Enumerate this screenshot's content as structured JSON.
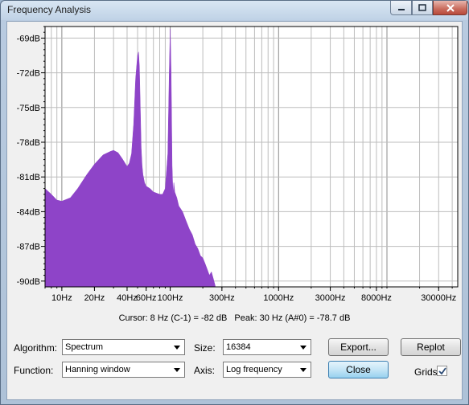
{
  "window": {
    "title": "Frequency Analysis",
    "accent": "#8e44c8"
  },
  "titlebar_buttons": [
    {
      "name": "minimize-button",
      "icon": "minimize-icon"
    },
    {
      "name": "maximize-button",
      "icon": "maximize-icon"
    },
    {
      "name": "close-window-button",
      "icon": "close-icon"
    }
  ],
  "plot": {
    "y_ticks": [
      "-69dB",
      "-72dB",
      "-75dB",
      "-78dB",
      "-81dB",
      "-84dB",
      "-87dB",
      "-90dB"
    ],
    "x_ticks": [
      "10Hz",
      "20Hz",
      "40Hz",
      "60Hz",
      "100Hz",
      "300Hz",
      "1000Hz",
      "3000Hz",
      "8000Hz",
      "30000Hz"
    ]
  },
  "readout": {
    "cursor": "Cursor: 8 Hz (C-1) = -82 dB",
    "peak": "Peak: 30 Hz (A#0) = -78.7 dB"
  },
  "controls": {
    "algorithm_label": "Algorithm:",
    "algorithm_value": "Spectrum",
    "size_label": "Size:",
    "size_value": "16384",
    "function_label": "Function:",
    "function_value": "Hanning window",
    "axis_label": "Axis:",
    "axis_value": "Log frequency",
    "export_label": "Export...",
    "replot_label": "Replot",
    "close_label": "Close",
    "grids_label": "Grids",
    "grids_checked": true
  },
  "chart_data": {
    "type": "area",
    "title": "",
    "xlabel": "",
    "ylabel": "",
    "x_scale": "log",
    "xlim": [
      7,
      45000
    ],
    "ylim": [
      -90.5,
      -68
    ],
    "grid": true,
    "color": "#8e44c8",
    "x_tick_labels": [
      "10Hz",
      "20Hz",
      "40Hz",
      "60Hz",
      "100Hz",
      "300Hz",
      "1000Hz",
      "3000Hz",
      "8000Hz",
      "30000Hz"
    ],
    "x_tick_values": [
      10,
      20,
      40,
      60,
      100,
      300,
      1000,
      3000,
      8000,
      30000
    ],
    "y_tick_labels": [
      "-69dB",
      "-72dB",
      "-75dB",
      "-78dB",
      "-81dB",
      "-84dB",
      "-87dB",
      "-90dB"
    ],
    "y_tick_values": [
      -69,
      -72,
      -75,
      -78,
      -81,
      -84,
      -87,
      -90
    ],
    "series": [
      {
        "x": [
          7,
          8,
          9,
          10,
          12,
          14,
          17,
          20,
          24,
          28,
          30,
          33,
          36,
          40,
          42,
          44,
          46,
          48,
          50,
          51,
          52,
          53,
          54,
          55,
          56,
          58,
          60,
          65,
          70,
          75,
          80,
          85,
          90,
          95,
          98,
          100,
          102,
          104,
          106,
          108,
          110,
          115,
          120,
          130,
          140,
          150,
          160,
          170,
          180,
          190,
          200,
          210,
          220,
          230,
          240,
          250,
          260
        ],
        "y": [
          -82.0,
          -82.5,
          -83.0,
          -83.1,
          -82.8,
          -82.0,
          -80.8,
          -79.9,
          -79.1,
          -78.8,
          -78.7,
          -78.9,
          -79.4,
          -80.1,
          -79.8,
          -79.0,
          -76.5,
          -72.5,
          -70.5,
          -70.2,
          -71.5,
          -75.0,
          -78.5,
          -80.0,
          -80.8,
          -81.5,
          -81.8,
          -82.0,
          -82.3,
          -82.4,
          -82.5,
          -82.5,
          -82.0,
          -79.0,
          -72.0,
          -68.2,
          -72.0,
          -80.0,
          -82.5,
          -81.5,
          -82.3,
          -82.8,
          -83.5,
          -84.0,
          -84.8,
          -85.5,
          -86.0,
          -86.8,
          -87.2,
          -87.8,
          -88.0,
          -88.5,
          -89.0,
          -89.5,
          -89.2,
          -89.8,
          -90.4
        ]
      }
    ]
  }
}
